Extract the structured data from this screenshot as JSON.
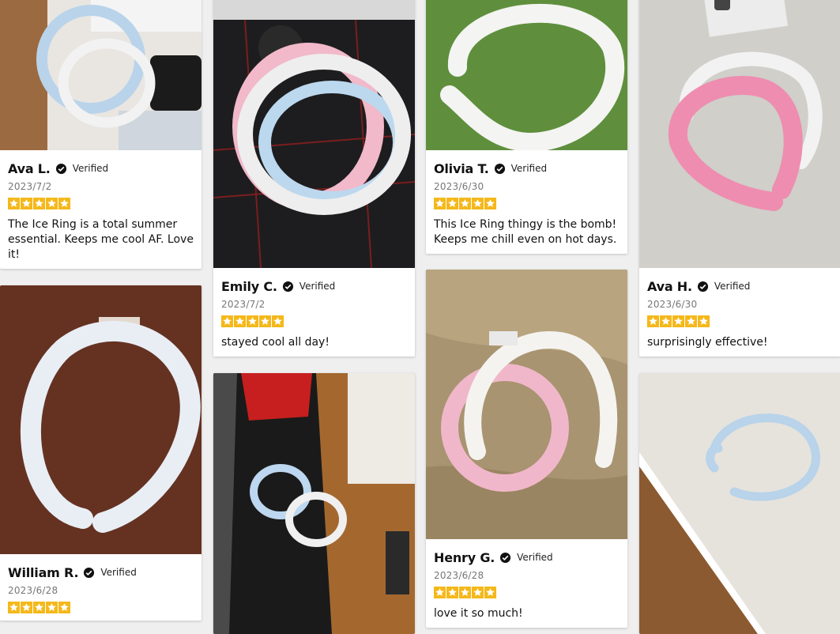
{
  "verified_label": "Verified",
  "colors": {
    "star": "#f5b81b",
    "text": "#111111",
    "date": "#777777"
  },
  "reviews": [
    {
      "name": "Ava L.",
      "date": "2023/7/2",
      "rating": 5,
      "text": "The Ice Ring is a total summer essential. Keeps me cool AF. Love it!"
    },
    {
      "name": "William R.",
      "date": "2023/6/28",
      "rating": 5,
      "text": ""
    },
    {
      "name": "Emily C.",
      "date": "2023/7/2",
      "rating": 5,
      "text": "stayed cool all day!"
    },
    {
      "name": "",
      "date": "",
      "rating": 0,
      "text": ""
    },
    {
      "name": "Olivia T.",
      "date": "2023/6/30",
      "rating": 5,
      "text": "This Ice Ring thingy is the bomb! Keeps me chill even on hot days."
    },
    {
      "name": "Henry G.",
      "date": "2023/6/28",
      "rating": 5,
      "text": "love it so much!"
    },
    {
      "name": "Ava H.",
      "date": "2023/6/30",
      "rating": 5,
      "text": "surprisingly effective!"
    },
    {
      "name": "",
      "date": "",
      "rating": 0,
      "text": ""
    }
  ]
}
